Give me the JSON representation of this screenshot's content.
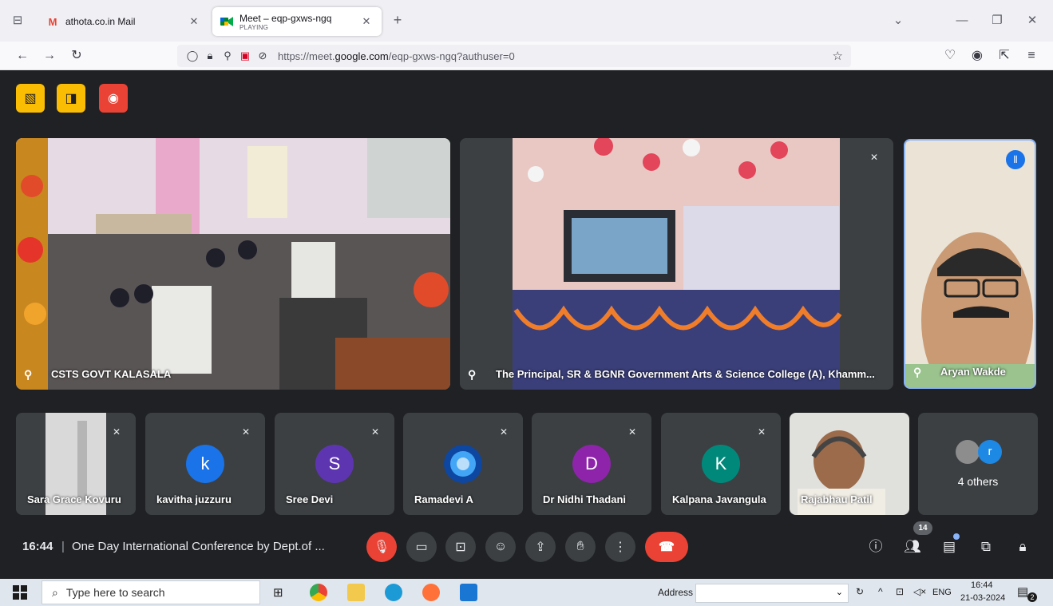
{
  "browser": {
    "tabs": [
      {
        "title": "athota.co.in Mail",
        "icon": "gmail-icon"
      },
      {
        "title": "Meet – eqp-gxws-ngq",
        "subtitle": "PLAYING",
        "icon": "meet-icon"
      }
    ],
    "url_prefix": "https://meet.",
    "url_host": "google.com",
    "url_path": "/eqp-gxws-ngq?authuser=0"
  },
  "meet": {
    "main_tiles": [
      {
        "name": "CSTS GOVT KALASALA"
      },
      {
        "name": "The Principal, SR & BGNR Government Arts & Science College (A), Khamm..."
      },
      {
        "name": "Aryan Wakde"
      }
    ],
    "participants": [
      {
        "name": "Sara Grace Kovuru",
        "avatar": "",
        "color": ""
      },
      {
        "name": "kavitha juzzuru",
        "avatar": "k",
        "color": "#1a73e8"
      },
      {
        "name": "Sree Devi",
        "avatar": "S",
        "color": "#5e35b1"
      },
      {
        "name": "Ramadevi A",
        "avatar": "",
        "color": "#1565c0"
      },
      {
        "name": "Dr Nidhi Thadani",
        "avatar": "D",
        "color": "#8e24aa"
      },
      {
        "name": "Kalpana Javangula",
        "avatar": "K",
        "color": "#00897b"
      },
      {
        "name": "Rajabhau Patil",
        "avatar": "",
        "color": ""
      }
    ],
    "others": {
      "label": "4 others",
      "avatar_letter": "r",
      "color": "#1e88e5"
    },
    "controls": {
      "time": "16:44",
      "separator": "|",
      "meeting_title": "One Day International Conference by Dept.of ...",
      "participant_count": "14"
    },
    "colors": {
      "accent_red": "#ea4335",
      "accent_yellow": "#fbbc04",
      "background": "#202124",
      "tile": "#3c4043"
    }
  },
  "taskbar": {
    "search_placeholder": "Type here to search",
    "address_label": "Address",
    "language": "ENG",
    "time": "16:44",
    "date": "21-03-2024",
    "notification_count": "2"
  }
}
